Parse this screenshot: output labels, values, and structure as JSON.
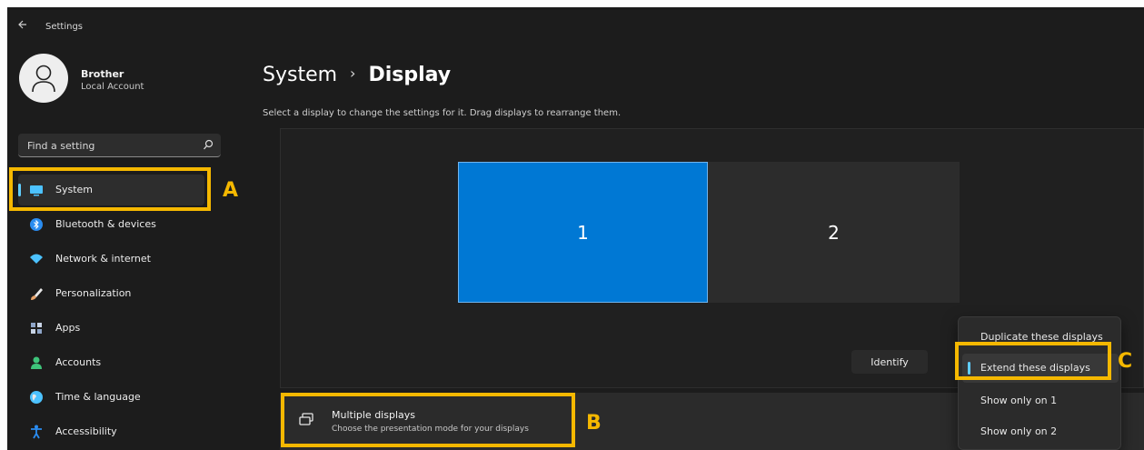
{
  "window": {
    "title": "Settings"
  },
  "profile": {
    "name": "Brother",
    "account_type": "Local Account"
  },
  "search": {
    "placeholder": "Find a setting"
  },
  "sidebar": {
    "items": [
      {
        "label": "System",
        "icon": "monitor-icon",
        "color": "#4cc2ff"
      },
      {
        "label": "Bluetooth & devices",
        "icon": "bluetooth-icon",
        "color": "#2a8cf0"
      },
      {
        "label": "Network & internet",
        "icon": "wifi-icon",
        "color": "#4cc2ff"
      },
      {
        "label": "Personalization",
        "icon": "brush-icon",
        "color": "#e8a36a"
      },
      {
        "label": "Apps",
        "icon": "apps-icon",
        "color": "#8ea5c8"
      },
      {
        "label": "Accounts",
        "icon": "person-icon",
        "color": "#3ec47a"
      },
      {
        "label": "Time & language",
        "icon": "globe-icon",
        "color": "#4cc2ff"
      },
      {
        "label": "Accessibility",
        "icon": "accessibility-icon",
        "color": "#2a8cf0"
      }
    ],
    "active_index": 0
  },
  "header": {
    "section": "System",
    "page": "Display",
    "separator": "›"
  },
  "main": {
    "subtitle": "Select a display to change the settings for it. Drag displays to rearrange them.",
    "monitors": [
      {
        "label": "1",
        "selected": true
      },
      {
        "label": "2",
        "selected": false
      }
    ],
    "identify_label": "Identify",
    "multiple_displays": {
      "title": "Multiple displays",
      "description": "Choose the presentation mode for your displays"
    }
  },
  "dropdown": {
    "options": [
      "Duplicate these displays",
      "Extend these displays",
      "Show only on 1",
      "Show only on 2"
    ],
    "selected_index": 1
  },
  "annotations": {
    "letters": [
      "A",
      "B",
      "C"
    ],
    "color": "#f5b800"
  },
  "colors": {
    "accent": "#0078d4",
    "indicator": "#60cdff",
    "background": "#1c1c1c"
  }
}
